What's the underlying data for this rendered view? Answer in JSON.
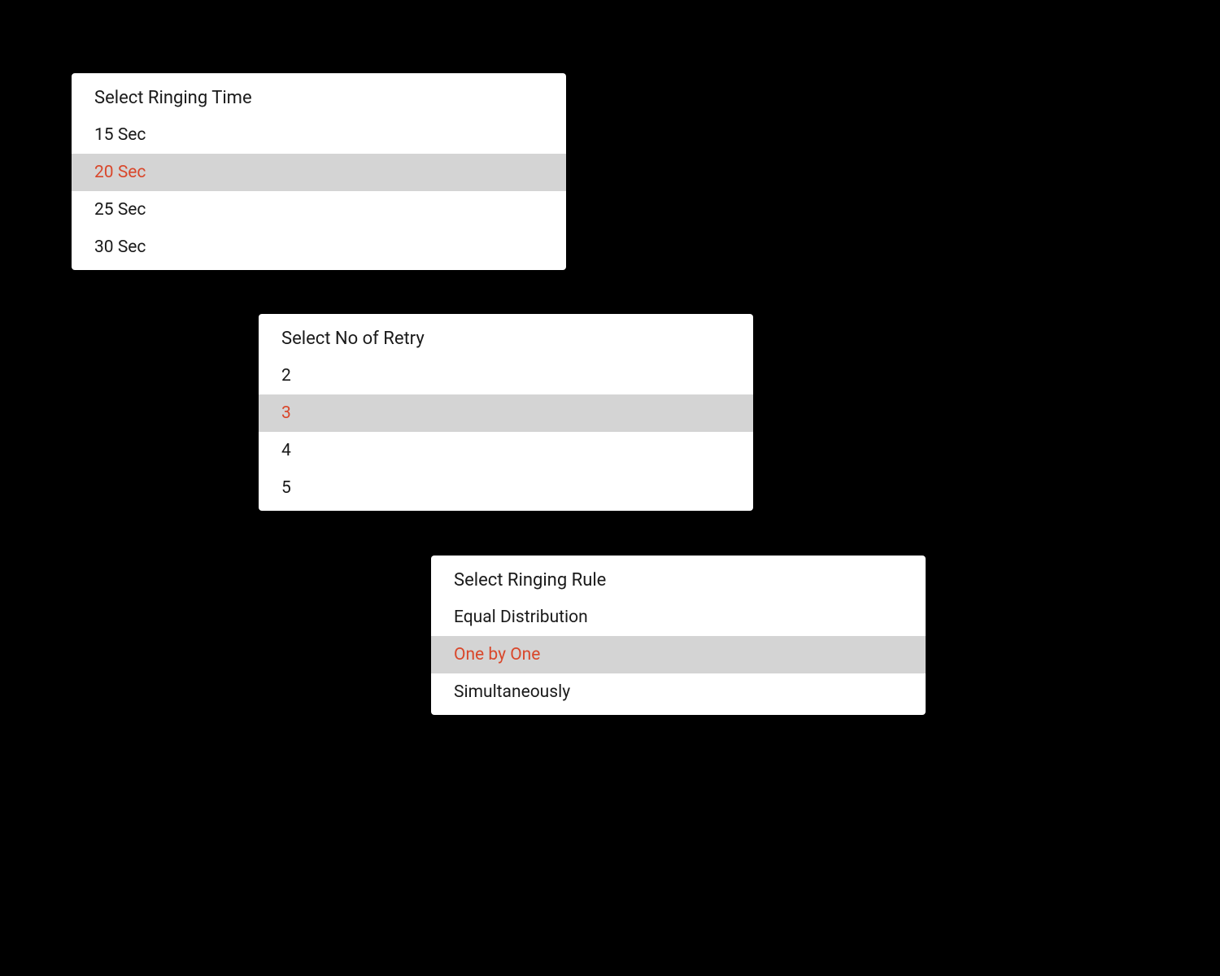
{
  "popups": {
    "ringingTime": {
      "title": "Select Ringing Time",
      "options": [
        {
          "label": "15 Sec",
          "selected": false
        },
        {
          "label": "20 Sec",
          "selected": true
        },
        {
          "label": "25 Sec",
          "selected": false
        },
        {
          "label": "30 Sec",
          "selected": false
        }
      ]
    },
    "retry": {
      "title": "Select No of Retry",
      "options": [
        {
          "label": "2",
          "selected": false
        },
        {
          "label": "3",
          "selected": true
        },
        {
          "label": "4",
          "selected": false
        },
        {
          "label": "5",
          "selected": false
        }
      ]
    },
    "ringingRule": {
      "title": "Select Ringing Rule",
      "options": [
        {
          "label": "Equal Distribution",
          "selected": false
        },
        {
          "label": "One by One",
          "selected": true
        },
        {
          "label": "Simultaneously",
          "selected": false
        }
      ]
    }
  },
  "colors": {
    "accent": "#d9472b",
    "selectedBg": "#d4d4d4"
  }
}
